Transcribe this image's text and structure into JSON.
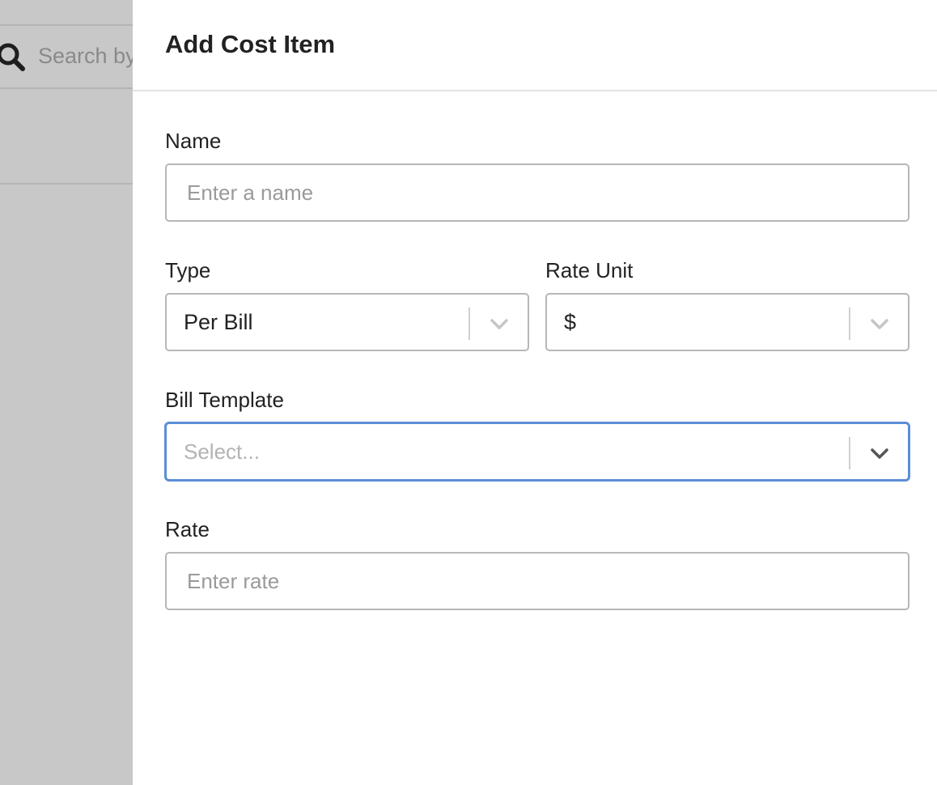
{
  "background": {
    "search_placeholder": "Search by"
  },
  "panel": {
    "title": "Add Cost Item"
  },
  "form": {
    "name": {
      "label": "Name",
      "placeholder": "Enter a name",
      "value": ""
    },
    "type": {
      "label": "Type",
      "value": "Per Bill"
    },
    "rate_unit": {
      "label": "Rate Unit",
      "value": "$"
    },
    "bill_template": {
      "label": "Bill Template",
      "placeholder": "Select..."
    },
    "rate": {
      "label": "Rate",
      "placeholder": "Enter rate",
      "value": ""
    }
  },
  "colors": {
    "backdrop": "#c8c8c8",
    "focus_border": "#5b8ed6",
    "input_border": "#b7b7b7",
    "text": "#222222",
    "placeholder": "#9a9a9a"
  },
  "icons": {
    "search": "search-icon",
    "chevron": "chevron-down-icon"
  }
}
